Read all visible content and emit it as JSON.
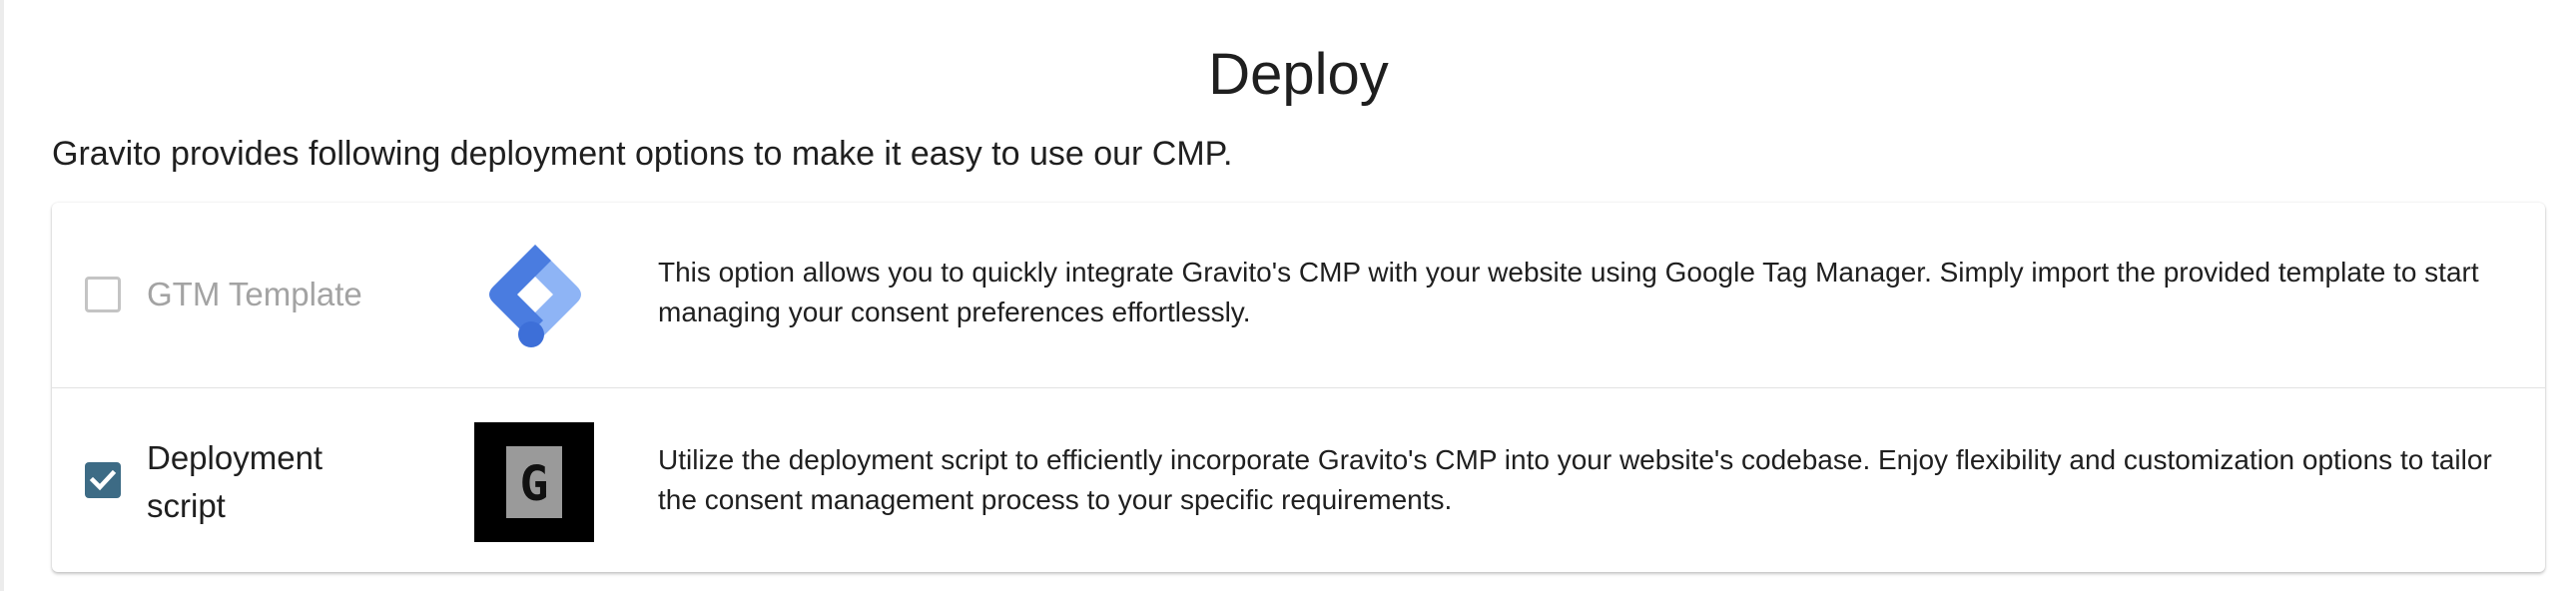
{
  "page": {
    "title": "Deploy",
    "intro": "Gravito provides following deployment options to make it easy to use our CMP."
  },
  "options": [
    {
      "label": "GTM Template",
      "checked": false,
      "logo": "google-tag-manager-icon",
      "description": "This option allows you to quickly integrate Gravito's CMP with your website using Google Tag Manager. Simply import the provided template to start managing your consent preferences effortlessly."
    },
    {
      "label_line1": "Deployment",
      "label_line2": "script",
      "checked": true,
      "logo": "gravito-g-icon",
      "logo_letter": "G",
      "description": "Utilize the deployment script to efficiently incorporate Gravito's CMP into your website's codebase. Enjoy flexibility and customization options to tailor the consent management process to your specific requirements."
    }
  ],
  "colors": {
    "checkbox_checked": "#3d6b85",
    "checkbox_unchecked_border": "#c4c4c4",
    "disabled_label": "#a3a3a3",
    "gtm_blue_dark": "#4a7ce0",
    "gtm_blue_light": "#8eb4f5",
    "gravito_logo_bg": "#000000",
    "gravito_logo_tile": "#9a9a9a"
  }
}
